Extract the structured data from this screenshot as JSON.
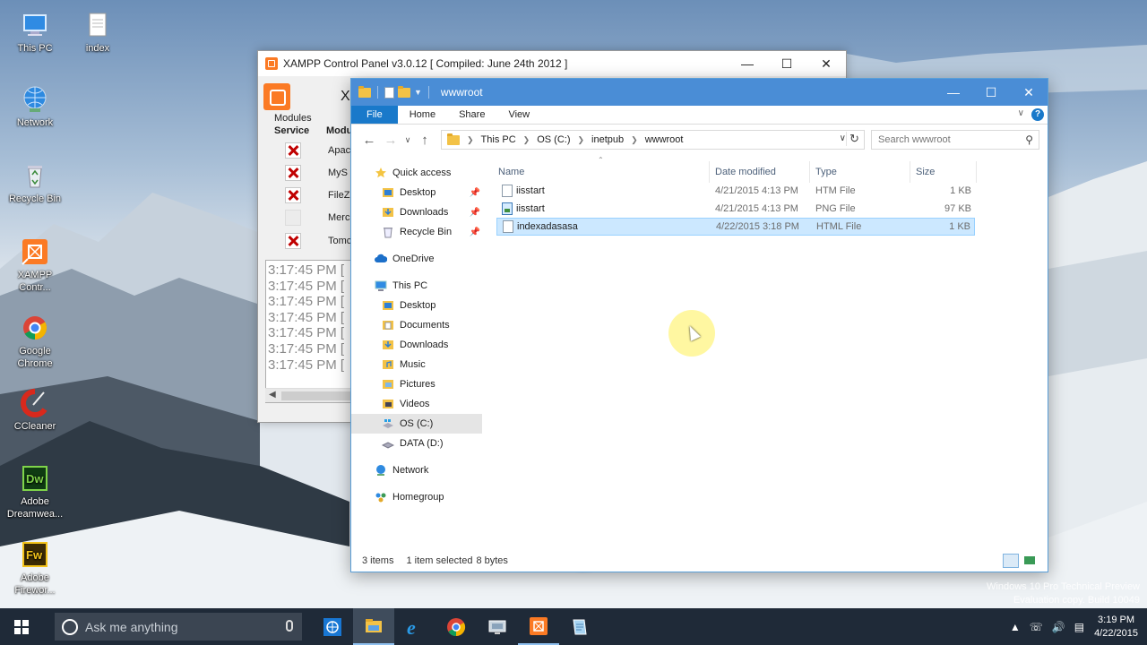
{
  "desktop": {
    "icons": [
      {
        "label": "This PC",
        "icon": "this-pc-icon"
      },
      {
        "label": "index",
        "icon": "text-file-icon"
      },
      {
        "label": "Network",
        "icon": "network-globe-icon"
      },
      {
        "label": "Recycle Bin",
        "icon": "recycle-bin-icon"
      },
      {
        "label": "XAMPP Contr...",
        "icon": "xampp-icon"
      },
      {
        "label": "Google Chrome",
        "icon": "chrome-icon"
      },
      {
        "label": "CCleaner",
        "icon": "ccleaner-icon"
      },
      {
        "label": "Adobe Dreamwea...",
        "icon": "dreamweaver-icon"
      },
      {
        "label": "Adobe Firewor...",
        "icon": "fireworks-icon"
      }
    ],
    "watermark": {
      "line1": "Windows 10 Pro Technical Preview",
      "line2": "Evaluation copy. Build 10049"
    }
  },
  "xampp": {
    "title": "XAMPP Control Panel v3.0.12  [ Compiled: June 24th 2012 ]",
    "cut_letter": "X",
    "modules_group": "Modules",
    "header_service": "Service",
    "header_module": "Modu",
    "services": [
      {
        "name": "Apac",
        "state": "stopped"
      },
      {
        "name": "MyS",
        "state": "stopped"
      },
      {
        "name": "FileZ",
        "state": "stopped"
      },
      {
        "name": "Merci",
        "state": "disabled"
      },
      {
        "name": "Tomc",
        "state": "stopped"
      }
    ],
    "log": [
      "3:17:45 PM  [",
      "3:17:45 PM  [",
      "3:17:45 PM  [",
      "3:17:45 PM  [",
      "3:17:45 PM  [",
      "3:17:45 PM  [",
      "3:17:45 PM  ["
    ]
  },
  "explorer": {
    "title": "wwwroot",
    "ribbon_tabs": [
      "File",
      "Home",
      "Share",
      "View"
    ],
    "help": "?",
    "breadcrumb": [
      "This PC",
      "OS (C:)",
      "inetpub",
      "wwwroot"
    ],
    "search_placeholder": "Search wwwroot",
    "nav": {
      "quick_access": "Quick access",
      "qa_items": [
        "Desktop",
        "Downloads",
        "Recycle Bin"
      ],
      "onedrive": "OneDrive",
      "this_pc": "This PC",
      "pc_items": [
        "Desktop",
        "Documents",
        "Downloads",
        "Music",
        "Pictures",
        "Videos",
        "OS (C:)",
        "DATA (D:)"
      ],
      "network": "Network",
      "homegroup": "Homegroup",
      "selected": "OS (C:)"
    },
    "columns": [
      "Name",
      "Date modified",
      "Type",
      "Size"
    ],
    "files": [
      {
        "name": "iisstart",
        "date": "4/21/2015 4:13 PM",
        "type": "HTM File",
        "size": "1 KB",
        "icon": "htm-file-icon",
        "selected": false
      },
      {
        "name": "iisstart",
        "date": "4/21/2015 4:13 PM",
        "type": "PNG File",
        "size": "97 KB",
        "icon": "png-file-icon",
        "selected": false
      },
      {
        "name": "indexadasasa",
        "date": "4/22/2015 3:18 PM",
        "type": "HTML File",
        "size": "1 KB",
        "icon": "html-file-icon",
        "selected": true
      }
    ],
    "status": {
      "items": "3 items",
      "selected": "1 item selected",
      "bytes": "8 bytes"
    }
  },
  "taskbar": {
    "search_placeholder": "Ask me anything",
    "apps": [
      "network-app-icon",
      "file-explorer-icon",
      "internet-explorer-icon",
      "chrome-icon",
      "remote-desktop-icon",
      "xampp-icon",
      "notes-icon"
    ],
    "time": "3:19 PM",
    "date": "4/22/2015"
  },
  "colors": {
    "accent": "#1979ca",
    "titlebar": "#4a8dd6",
    "selection": "#cce8ff",
    "xampp_orange": "#fb7a24",
    "taskbar": "#1f2a38"
  }
}
